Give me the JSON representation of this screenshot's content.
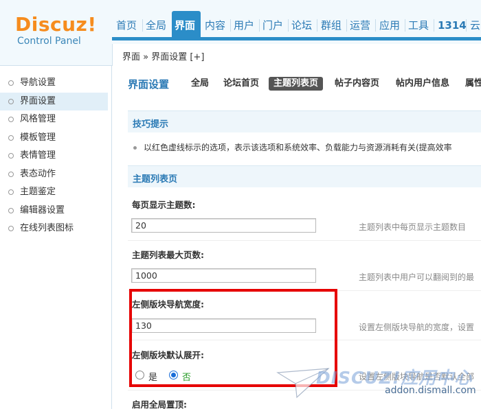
{
  "logo": {
    "brand": "Discuz!",
    "subtitle": "Control Panel"
  },
  "topnav": {
    "items": [
      "首页",
      "全局",
      "界面",
      "内容",
      "用户",
      "门户",
      "论坛",
      "群组",
      "运营",
      "应用",
      "工具",
      "1314",
      "云"
    ],
    "active_index": 2
  },
  "breadcrumb": "界面 » 界面设置  [+]",
  "sidebar": {
    "items": [
      "导航设置",
      "界面设置",
      "风格管理",
      "模板管理",
      "表情管理",
      "表态动作",
      "主题鉴定",
      "编辑器设置",
      "在线列表图标"
    ],
    "active_index": 1
  },
  "main": {
    "section_title": "界面设置",
    "tabs": [
      "全局",
      "论坛首页",
      "主题列表页",
      "帖子内容页",
      "帖内用户信息",
      "属性"
    ],
    "current_tab_index": 2,
    "tips_header": "技巧提示",
    "tip_text": "以红色虚线标示的选项，表示该选项和系统效率、负载能力与资源消耗有关(提高效率",
    "list_header": "主题列表页",
    "settings": [
      {
        "label": "每页显示主题数:",
        "value": "20",
        "desc": "主题列表中每页显示主题数目"
      },
      {
        "label": "主题列表最大页数:",
        "value": "1000",
        "desc": "主题列表中用户可以翻阅到的最"
      },
      {
        "label": "左侧版块导航宽度:",
        "value": "130",
        "desc": "设置左侧版块导航的宽度，设置"
      },
      {
        "label": "左侧版块默认展开:",
        "desc": "设置左侧版块导航是否默认全部"
      }
    ],
    "radio": {
      "yes": "是",
      "no": "否",
      "selected": "no"
    },
    "next_label": "启用全局置顶:"
  },
  "watermark": {
    "text": "DISCUZ!应用中心",
    "url": "addon.dismall.com"
  },
  "colors": {
    "accent": "#2b8dc8",
    "brand_orange": "#f68c1e",
    "highlight_red": "#e60000"
  }
}
